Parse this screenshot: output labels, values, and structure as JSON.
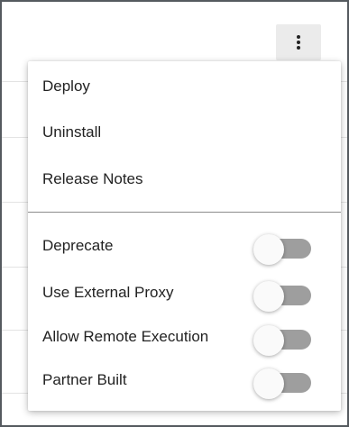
{
  "toolbar": {
    "overflow_icon": "more-vert-icon"
  },
  "menu": {
    "actions": [
      {
        "label": "Deploy"
      },
      {
        "label": "Uninstall"
      },
      {
        "label": "Release Notes"
      }
    ],
    "toggles": [
      {
        "label": "Deprecate",
        "checked": false
      },
      {
        "label": "Use External Proxy",
        "checked": false
      },
      {
        "label": "Allow Remote Execution",
        "checked": false
      },
      {
        "label": "Partner Built",
        "checked": false
      }
    ]
  },
  "colors": {
    "frame_border": "#555a5f",
    "switch_track_off": "#9e9e9e",
    "switch_thumb": "#fafafa",
    "button_bg": "#ebebeb",
    "text": "#222222"
  }
}
